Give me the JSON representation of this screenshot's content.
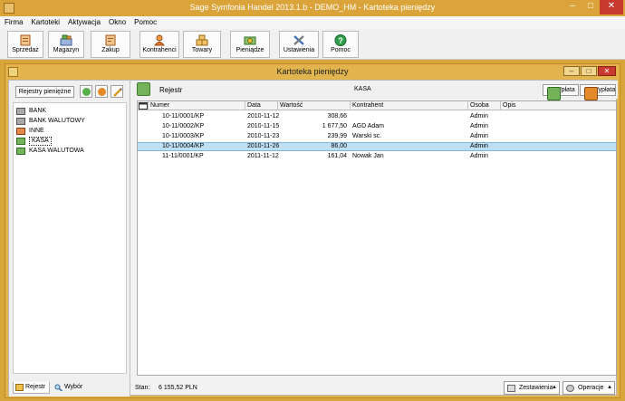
{
  "window": {
    "title": "Sage Symfonia Handel 2013.1.b - DEMO_HM - Kartoteka pieniędzy",
    "min_glyph": "–",
    "max_glyph": "□",
    "close_glyph": "✕"
  },
  "menu": [
    "Firma",
    "Kartoteki",
    "Aktywacja",
    "Okno",
    "Pomoc"
  ],
  "toolbar": [
    {
      "label": "Sprzedaż",
      "icon": "sales-document-icon",
      "color": "#d8833a"
    },
    {
      "label": "Magazyn",
      "icon": "warehouse-icon",
      "color": "#6c8fc4"
    },
    {
      "label": "Zakup",
      "icon": "purchase-document-icon",
      "color": "#d8833a"
    },
    {
      "label": "Kontrahenci",
      "icon": "contractor-person-icon",
      "color": "#e0792a"
    },
    {
      "label": "Towary",
      "icon": "goods-boxes-icon",
      "color": "#e3a23d"
    },
    {
      "label": "Pieniądze",
      "icon": "money-icon",
      "color": "#5aa34a"
    },
    {
      "label": "Ustawienia",
      "icon": "settings-tools-icon",
      "color": "#3a6fc0"
    },
    {
      "label": "Pomoc",
      "icon": "help-icon",
      "color": "#2e9d4b"
    }
  ],
  "child": {
    "title": "Kartoteka pieniędzy",
    "min_glyph": "–",
    "max_glyph": "□",
    "close_glyph": "✕"
  },
  "left": {
    "registers_button": "Rejestry pieniężne",
    "tree": [
      {
        "label": "BANK",
        "icon": "bank-icon",
        "selected": false
      },
      {
        "label": "BANK WALUTOWY",
        "icon": "bank-icon",
        "selected": false
      },
      {
        "label": "INNE",
        "icon": "other-register-icon",
        "selected": false
      },
      {
        "label": "KASA",
        "icon": "cash-register-icon",
        "selected": true
      },
      {
        "label": "KASA WALUTOWA",
        "icon": "cash-register-icon",
        "selected": false
      }
    ],
    "tabs": [
      {
        "label": "Rejestr",
        "icon": "folder-icon"
      },
      {
        "label": "Wybór",
        "icon": "search-icon"
      }
    ]
  },
  "right": {
    "header_label": "Rejestr",
    "register_name": "KASA",
    "buttons": {
      "wplata": "Wpłata",
      "wyplata": "Wypłata"
    },
    "columns": [
      "Numer",
      "Data",
      "Wartość",
      "Kontrahent",
      "Osoba",
      "Opis"
    ],
    "rows": [
      {
        "numer": "10-11/0001/KP",
        "data": "2010-11-12",
        "wartosc": "308,66",
        "kontrahent": "",
        "osoba": "Admin",
        "opis": "",
        "selected": false
      },
      {
        "numer": "10-11/0002/KP",
        "data": "2010-11-15",
        "wartosc": "1 677,50",
        "kontrahent": "AGD Adam",
        "osoba": "Admin",
        "opis": "",
        "selected": false
      },
      {
        "numer": "10-11/0003/KP",
        "data": "2010-11-23",
        "wartosc": "239,99",
        "kontrahent": "Warski sc.",
        "osoba": "Admin",
        "opis": "",
        "selected": false
      },
      {
        "numer": "10-11/0004/KP",
        "data": "2010-11-26",
        "wartosc": "86,00",
        "kontrahent": "",
        "osoba": "Admin",
        "opis": "",
        "selected": true
      },
      {
        "numer": "11-11/0001/KP",
        "data": "2011-11-12",
        "wartosc": "161,04",
        "kontrahent": "Nowak Jan",
        "osoba": "Admin",
        "opis": "",
        "selected": false
      }
    ],
    "footer": {
      "stan_label": "Stan:",
      "stan_value": "6 155,52 PLN",
      "zestawienia": "Zestawienia",
      "operacje": "Operacje"
    }
  },
  "colors": {
    "frame": "#d9a63b",
    "selection": "#bfe0f4",
    "close": "#c8392e"
  }
}
